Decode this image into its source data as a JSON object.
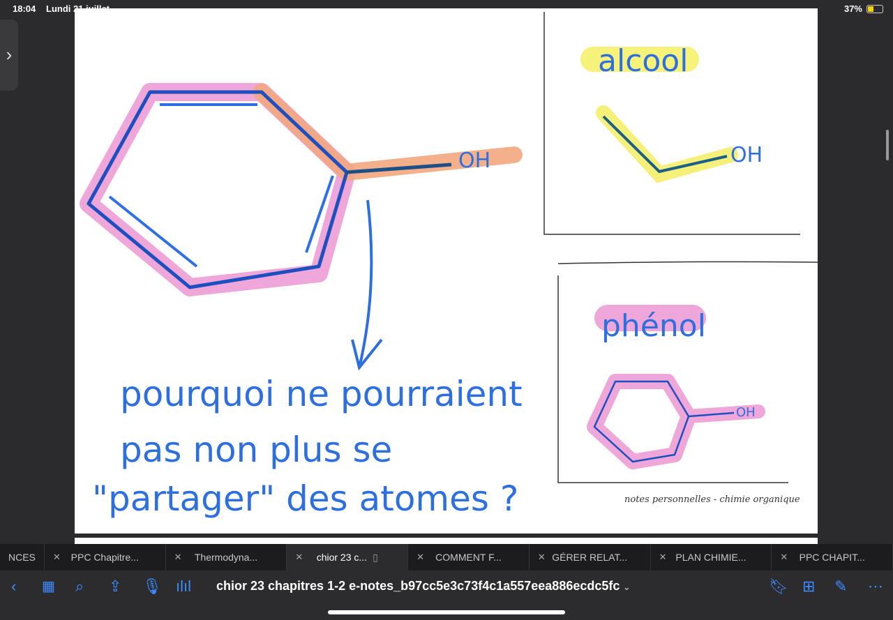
{
  "status": {
    "time": "18:04",
    "date": "Lundi 21 juillet",
    "battery": "37%",
    "battery_level": 37
  },
  "note": {
    "oh_main": "OH",
    "alcool_label": "alcool",
    "alcool_oh": "OH",
    "phenol_label": "phénol",
    "phenol_oh": "OH",
    "question_lines": [
      "pourquoi ne pourraient",
      "pas non plus se",
      "\"partager\" des atomes ?"
    ],
    "footer": "notes personnelles - chimie organique"
  },
  "tabs": [
    {
      "label": "NCES",
      "active": false
    },
    {
      "label": "PPC Chapitre...",
      "active": false
    },
    {
      "label": "Thermodyna...",
      "active": false
    },
    {
      "label": "chior 23 c...",
      "active": true
    },
    {
      "label": "COMMENT F...",
      "active": false
    },
    {
      "label": "GÉRER RELAT...",
      "active": false
    },
    {
      "label": "PLAN CHIMIE...",
      "active": false
    },
    {
      "label": "PPC CHAPIT...",
      "active": false
    }
  ],
  "toolbar": {
    "title": "chior 23 chapitres 1-2 e-notes_b97cc5e3c73f4c1a557eea886ecdc5fc",
    "chevron": "⌄"
  }
}
